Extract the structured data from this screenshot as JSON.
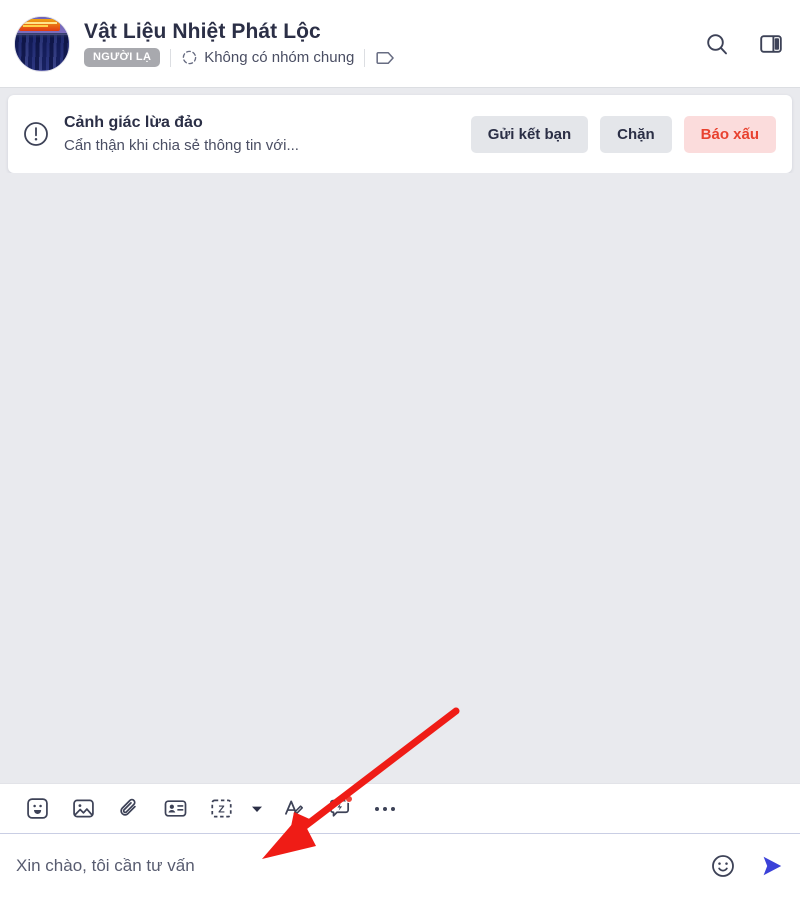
{
  "header": {
    "name": "Vật Liệu Nhiệt Phát Lộc",
    "stranger_badge": "NGƯỜI LẠ",
    "no_common_group": "Không có nhóm chung",
    "icons": {
      "group": "dashed-circle-group-icon",
      "tag": "tag-icon",
      "search": "search-icon",
      "panel": "side-panel-toggle-icon"
    }
  },
  "warning": {
    "icon": "alert-circle-icon",
    "title": "Cảnh giác lừa đảo",
    "description": "Cẩn thận khi chia sẻ thông tin với...",
    "buttons": {
      "add_friend": "Gửi kết bạn",
      "block": "Chặn",
      "report": "Báo xấu"
    },
    "colors": {
      "button_gray_bg": "#e4e6ea",
      "report_bg": "#fbdcdc",
      "report_text": "#e8412f"
    }
  },
  "toolbar": {
    "items": [
      {
        "name": "sticker-icon",
        "label": "Sticker"
      },
      {
        "name": "image-icon",
        "label": "Gửi hình ảnh"
      },
      {
        "name": "paperclip-icon",
        "label": "Đính kèm file"
      },
      {
        "name": "contact-card-icon",
        "label": "Gửi danh thiếp"
      },
      {
        "name": "screen-capture-z-icon",
        "label": "Chụp màn hình"
      },
      {
        "name": "chevron-down-icon",
        "label": "Tùy chọn chụp"
      },
      {
        "name": "format-text-icon",
        "label": "Định dạng tin nhắn"
      },
      {
        "name": "quick-message-icon",
        "label": "Tin nhắn nhanh"
      },
      {
        "name": "more-options-icon",
        "label": "Tùy chọn khác"
      }
    ]
  },
  "composer": {
    "placeholder": "Xin chào, tôi cần tư vấn",
    "value": "",
    "emoji_icon": "emoji-smiley-icon",
    "send_icon": "send-arrow-icon",
    "send_color": "#3b41d8"
  },
  "annotation": {
    "arrow_color": "#ef1c16",
    "points_to": "message-input-field"
  },
  "colors": {
    "chat_background": "#e9eaee",
    "header_background": "#ffffff",
    "text_primary": "#2b2f46",
    "text_secondary": "#4a4e63"
  }
}
